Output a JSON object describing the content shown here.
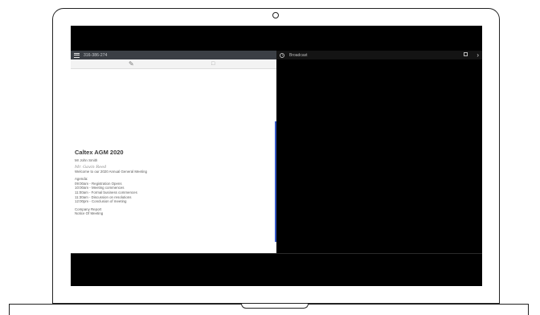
{
  "device": {
    "camera_icon": "camera-icon"
  },
  "left_app": {
    "menu_icon": "hamburger-icon",
    "id_text": "316-386-274",
    "toolbar": {
      "edit_icon": "pencil-icon",
      "chat_icon": "chat-icon"
    },
    "document": {
      "title": "Caltex AGM 2020",
      "author": "Mr John Smith",
      "signature": "Mr. Gavin Reed",
      "welcome": "Welcome to our 2020 Annual General Meeting",
      "agenda_heading": "Agenda:",
      "agenda_items": [
        "09:00am - Registration Opens",
        "10:00am - Meeting commences",
        "11:00am - Formal business commences",
        "11:30am - Discussion on resolutions",
        "12:00pm - Conclusion of meeting"
      ],
      "links": [
        "Company Report",
        "Notice Of Meeting"
      ]
    },
    "accent_color": "#3558c8"
  },
  "right_app": {
    "logo_icon": "broadcast-logo-icon",
    "label": "Broadcast",
    "fullscreen_icon": "fullscreen-icon",
    "next_icon": "chevron-right-icon"
  }
}
